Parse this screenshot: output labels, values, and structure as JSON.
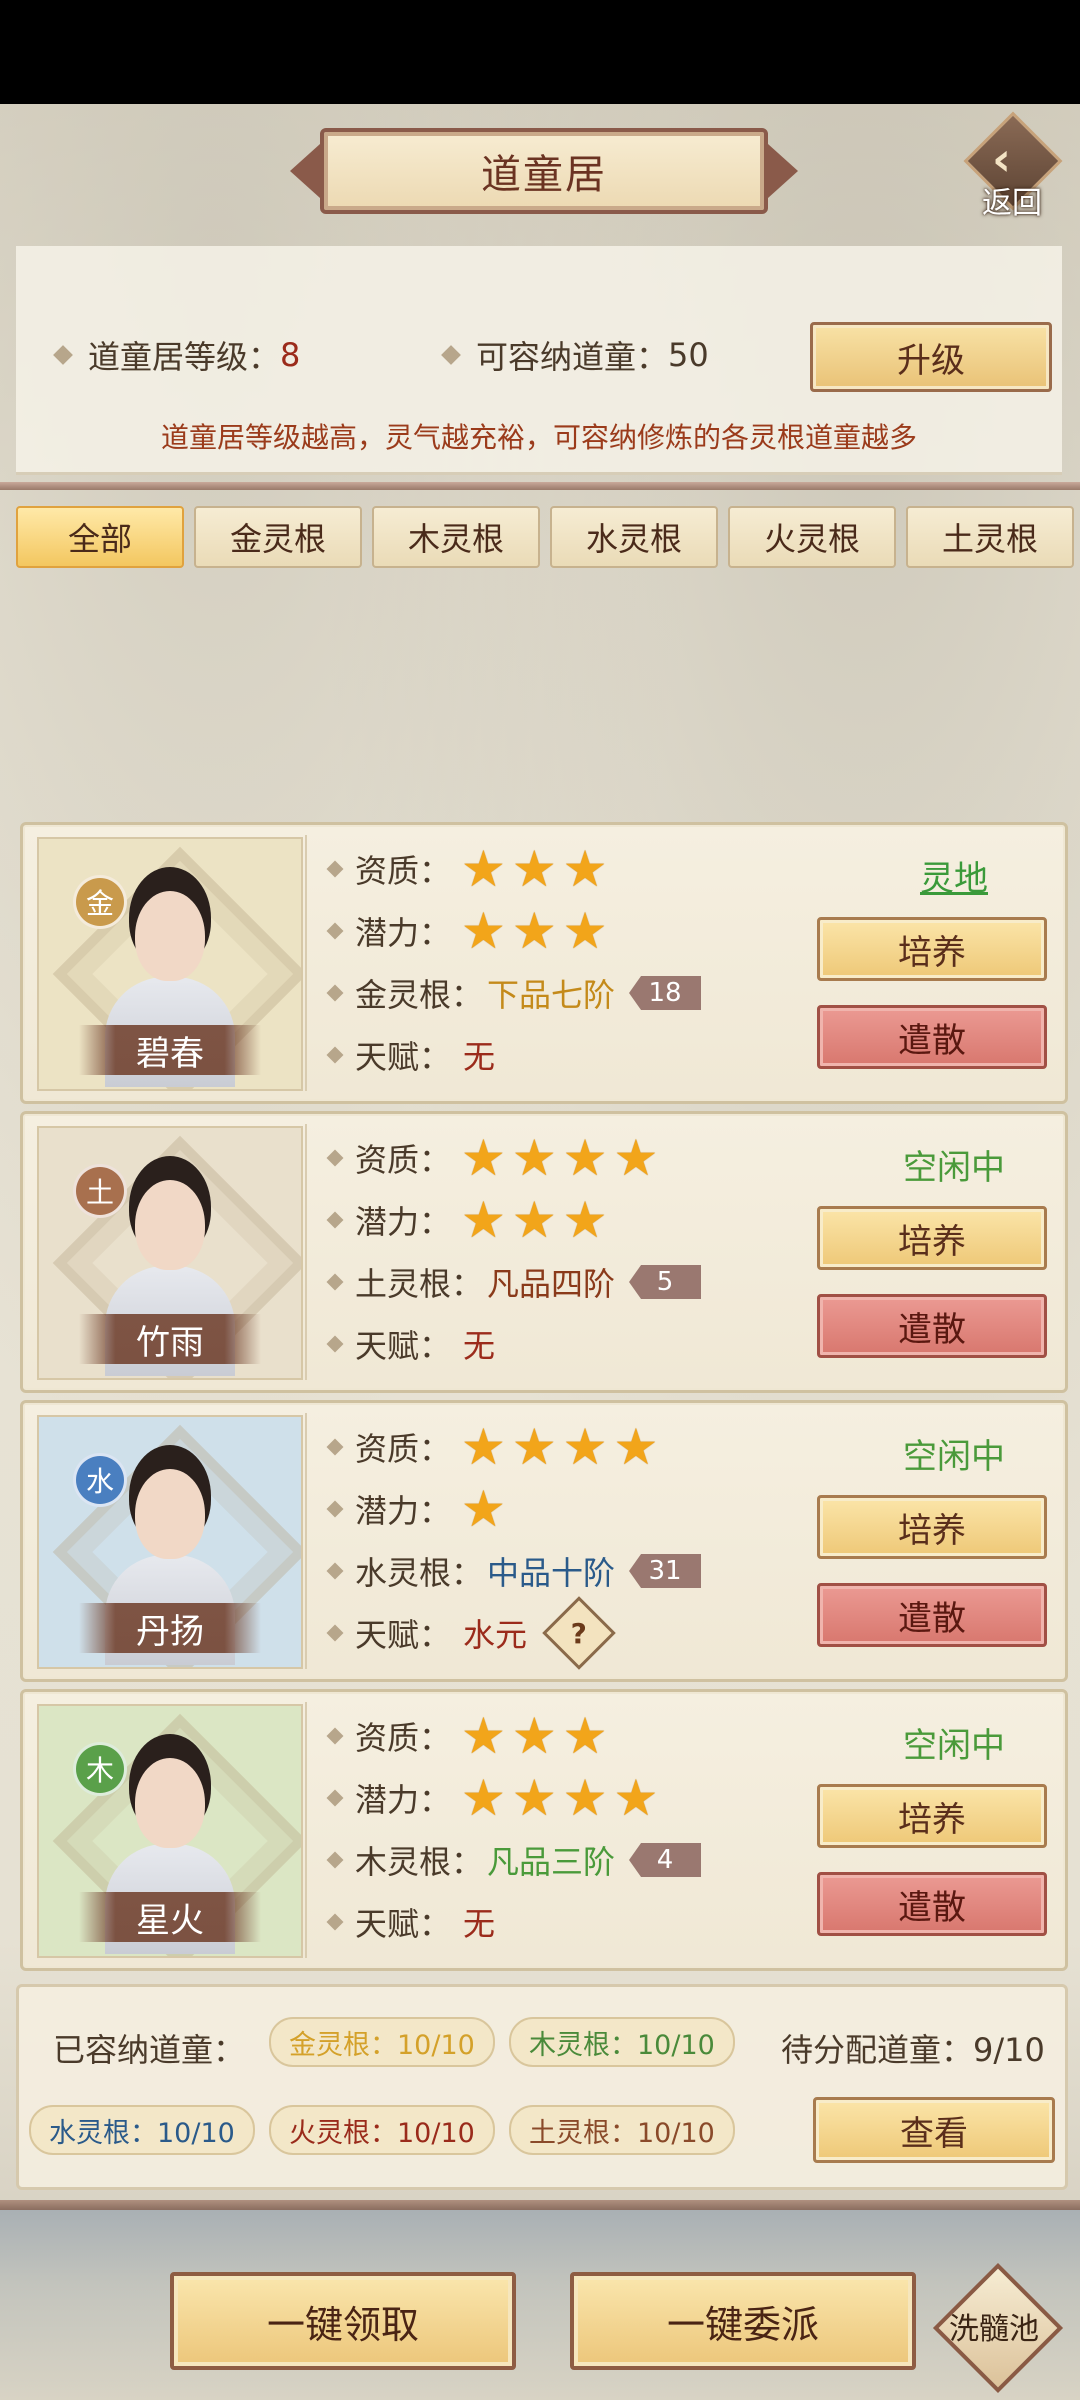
{
  "header": {
    "title": "道童居",
    "back_label": "返回"
  },
  "info": {
    "level_label": "道童居等级：",
    "level_value": "8",
    "capacity_label": "可容纳道童：",
    "capacity_value": "50",
    "upgrade_label": "升级",
    "tip": "道童居等级越高，灵气越充裕，可容纳修炼的各灵根道童越多"
  },
  "tabs": [
    {
      "label": "全部",
      "active": true
    },
    {
      "label": "金灵根",
      "active": false
    },
    {
      "label": "木灵根",
      "active": false
    },
    {
      "label": "水灵根",
      "active": false
    },
    {
      "label": "火灵根",
      "active": false
    },
    {
      "label": "土灵根",
      "active": false
    }
  ],
  "labels": {
    "aptitude": "资质：",
    "potential": "潜力：",
    "talent": "天赋：",
    "train": "培养",
    "dismiss": "遣散"
  },
  "cards": [
    {
      "name": "碧春",
      "element": "金",
      "element_color": "#c99a4c",
      "portrait_bg": "#ece3c4",
      "aptitude_stars": 3,
      "potential_stars": 3,
      "root_label": "金灵根：",
      "root_value": "下品七阶",
      "root_color": "#c48a1a",
      "grade": "18",
      "talent_value": "无",
      "talent_has_help": false,
      "status": "灵地",
      "status_color": "#3a9a3a",
      "status_underline": true
    },
    {
      "name": "竹雨",
      "element": "土",
      "element_color": "#a8704e",
      "portrait_bg": "#e9e0cc",
      "aptitude_stars": 4,
      "potential_stars": 3,
      "root_label": "土灵根：",
      "root_value": "凡品四阶",
      "root_color": "#8a3a1a",
      "grade": "5",
      "talent_value": "无",
      "talent_has_help": false,
      "status": "空闲中",
      "status_color": "#4a9a3a",
      "status_underline": false
    },
    {
      "name": "丹扬",
      "element": "水",
      "element_color": "#4a7fc0",
      "portrait_bg": "#cfe0ea",
      "aptitude_stars": 4,
      "potential_stars": 1,
      "root_label": "水灵根：",
      "root_value": "中品十阶",
      "root_color": "#2a5a8a",
      "grade": "31",
      "talent_value": "水元",
      "talent_has_help": true,
      "help_glyph": "?",
      "status": "空闲中",
      "status_color": "#4a9a3a",
      "status_underline": false
    },
    {
      "name": "星火",
      "element": "木",
      "element_color": "#5aa04a",
      "portrait_bg": "#dbe6c4",
      "aptitude_stars": 3,
      "potential_stars": 4,
      "root_label": "木灵根：",
      "root_value": "凡品三阶",
      "root_color": "#4a9a3a",
      "grade": "4",
      "talent_value": "无",
      "talent_has_help": false,
      "status": "空闲中",
      "status_color": "#4a9a3a",
      "status_underline": false
    }
  ],
  "summary": {
    "label": "已容纳道童：",
    "pills": [
      {
        "text": "金灵根：10/10",
        "color": "#d4a12a"
      },
      {
        "text": "木灵根：10/10",
        "color": "#4a8a3a"
      },
      {
        "text": "水灵根：10/10",
        "color": "#2a5a8a"
      },
      {
        "text": "火灵根：10/10",
        "color": "#9a2b1b"
      },
      {
        "text": "土灵根：10/10",
        "color": "#8a4a2a"
      }
    ],
    "pending": "待分配道童：9/10",
    "view_label": "查看"
  },
  "footer": {
    "collect_all": "一键领取",
    "dispatch_all": "一键委派",
    "pool": "洗髓池"
  }
}
